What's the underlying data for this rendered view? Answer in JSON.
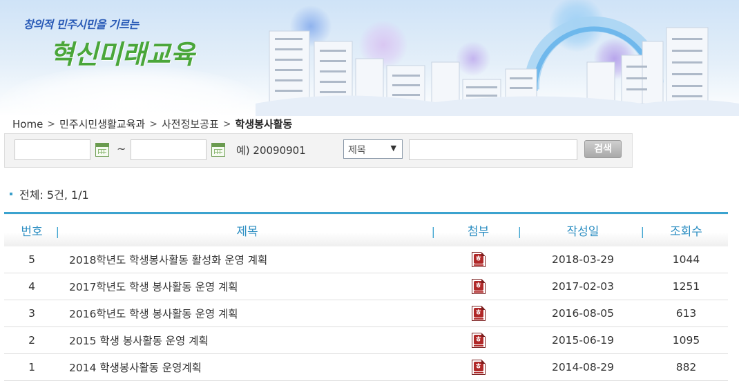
{
  "banner": {
    "slogan_small": "창의적 민주시민을 기르는",
    "slogan_big": "혁신미래교육"
  },
  "breadcrumb": {
    "items": [
      "Home",
      "민주시민생활교육과",
      "사전정보공표"
    ],
    "current": "학생봉사활동"
  },
  "search": {
    "start_date_value": "",
    "end_date_value": "",
    "range_separator": "~",
    "date_example": "예) 20090901",
    "field_select": "제목",
    "keyword_value": "",
    "button_label": "검색"
  },
  "summary": {
    "total_text": "전체: 5건, 1/1"
  },
  "table": {
    "headers": [
      "번호",
      "제목",
      "첨부",
      "작성일",
      "조회수"
    ],
    "rows": [
      {
        "no": "5",
        "title": "2018학년도 학생봉사활동 활성화 운영 계획",
        "attachment": "hwp-icon",
        "date": "2018-03-29",
        "views": "1044"
      },
      {
        "no": "4",
        "title": "2017학년도 학생 봉사활동 운영 계획",
        "attachment": "hwp-icon",
        "date": "2017-02-03",
        "views": "1251"
      },
      {
        "no": "3",
        "title": "2016학년도 학생 봉사활동 운영 계획",
        "attachment": "hwp-icon",
        "date": "2016-08-05",
        "views": "613"
      },
      {
        "no": "2",
        "title": "2015 학생 봉사활동 운영 계획",
        "attachment": "hwp-icon",
        "date": "2015-06-19",
        "views": "1095"
      },
      {
        "no": "1",
        "title": "2014 학생봉사활동 운영계획",
        "attachment": "hwp-icon",
        "date": "2014-08-29",
        "views": "882"
      }
    ]
  },
  "colors": {
    "accent": "#3ba3cf",
    "header_text": "#2c8ec2",
    "slogan_green": "#4aa63a",
    "slogan_blue": "#2a5bb7"
  }
}
